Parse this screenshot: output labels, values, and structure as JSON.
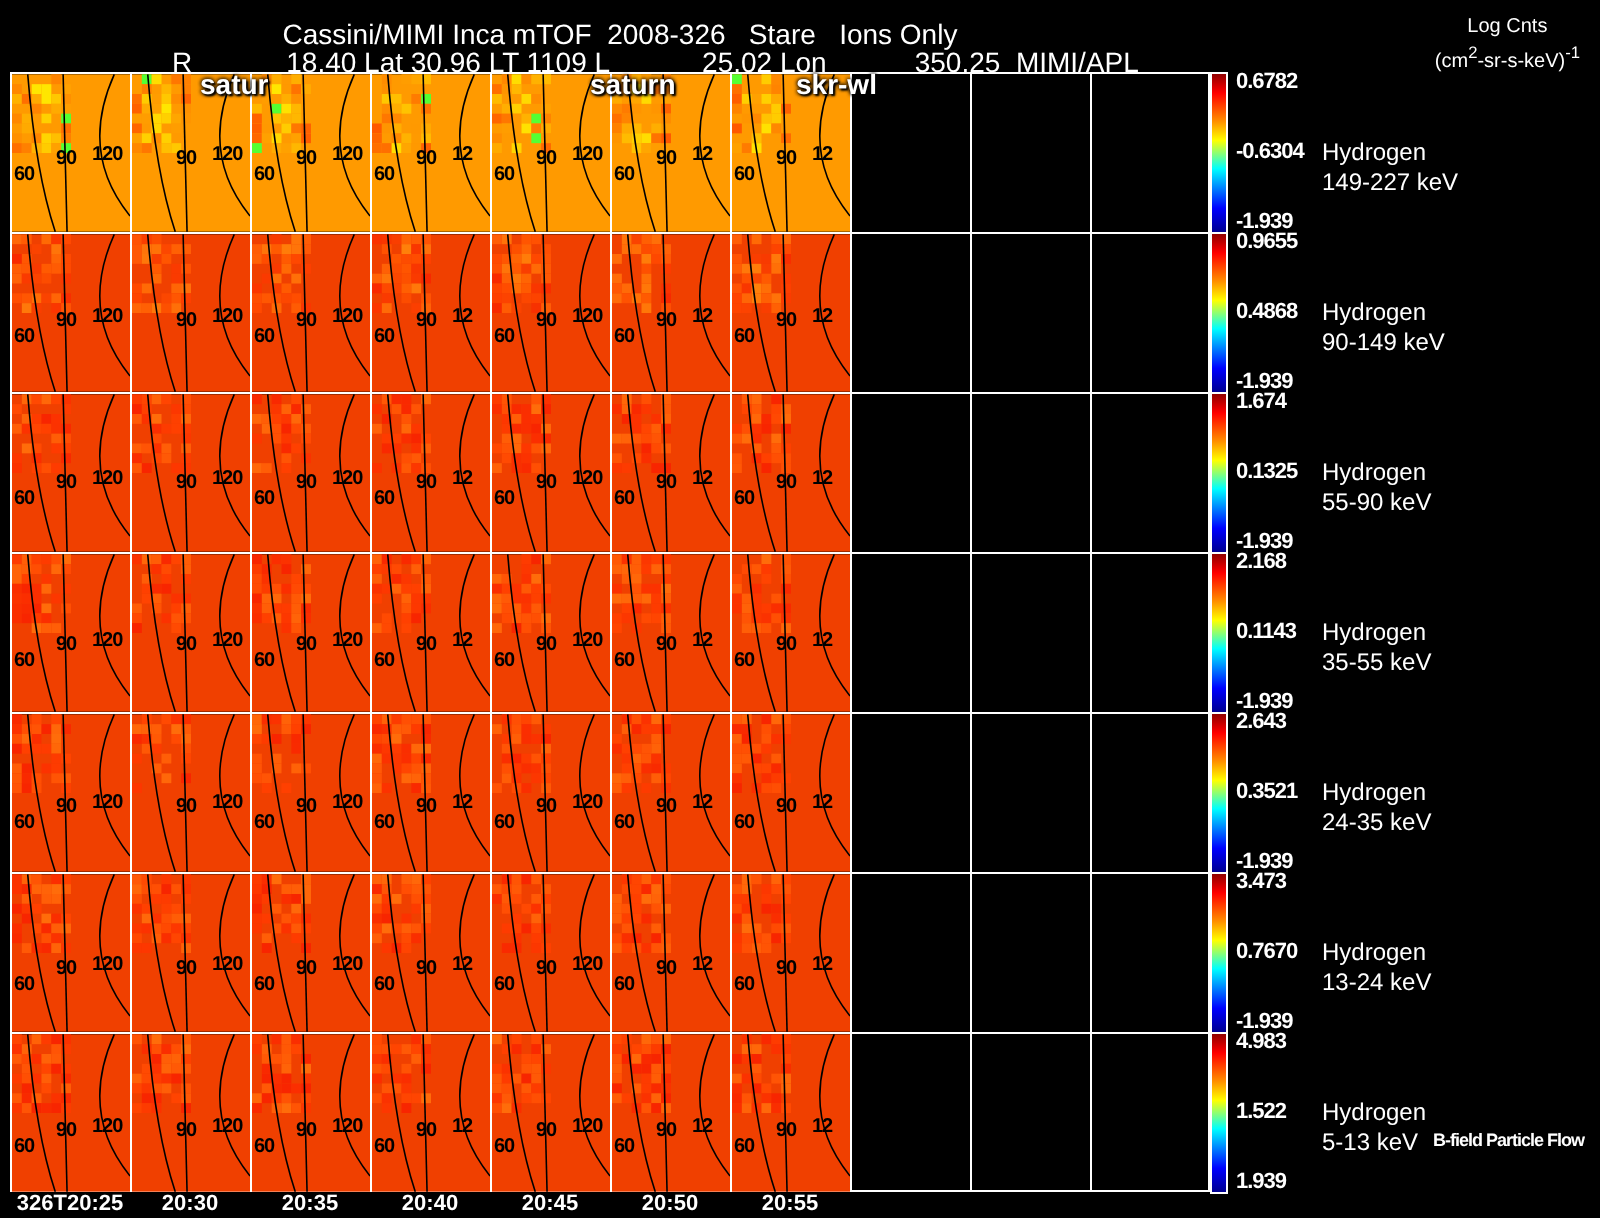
{
  "title": "Cassini/MIMI Inca mTOF  2008-326   Stare   Ions Only",
  "subtitle": [
    "R",
    "18.40 Lat 30.96 LT 1109 L",
    "25.02 Lon",
    "350.25  MIMI/APL"
  ],
  "units": {
    "line1": "Log Cnts",
    "line2": "(cm$^{2}$-sr-s-keV)$^{-1}$"
  },
  "overlay_labels": [
    "satur",
    "saturn",
    "skr-wl"
  ],
  "panels": [
    {
      "species": "Hydrogen",
      "energy": "149-227 keV",
      "scale_max": "0.6782",
      "scale_mid": "-0.6304",
      "scale_min": "-1.939",
      "contours": [
        [
          "60",
          "90",
          "120"
        ],
        [
          "90",
          "120"
        ],
        [
          "60",
          "90",
          "120"
        ],
        [
          "60",
          "90",
          "12"
        ],
        [
          "60",
          "90",
          "120"
        ],
        [
          "60",
          "90",
          "12"
        ],
        [
          "60",
          "90",
          "12"
        ]
      ]
    },
    {
      "species": "Hydrogen",
      "energy": "90-149 keV",
      "scale_max": "0.9655",
      "scale_mid": "0.4868",
      "scale_min": "-1.939",
      "contours": [
        [
          "60",
          "90",
          "120"
        ],
        [
          "90",
          "120"
        ],
        [
          "60",
          "90",
          "120"
        ],
        [
          "60",
          "90",
          "12"
        ],
        [
          "60",
          "90",
          "120"
        ],
        [
          "60",
          "90",
          "12"
        ],
        [
          "60",
          "90",
          "12"
        ]
      ]
    },
    {
      "species": "Hydrogen",
      "energy": "55-90 keV",
      "scale_max": "1.674",
      "scale_mid": "0.1325",
      "scale_min": "-1.939",
      "contours": [
        [
          "60",
          "90",
          "120"
        ],
        [
          "90",
          "120"
        ],
        [
          "60",
          "90",
          "120"
        ],
        [
          "60",
          "90",
          "12"
        ],
        [
          "60",
          "90",
          "120"
        ],
        [
          "60",
          "90",
          "12"
        ],
        [
          "60",
          "90",
          "12"
        ]
      ]
    },
    {
      "species": "Hydrogen",
      "energy": "35-55 keV",
      "scale_max": "2.168",
      "scale_mid": "0.1143",
      "scale_min": "-1.939",
      "contours": [
        [
          "60",
          "90",
          "120"
        ],
        [
          "90",
          "120"
        ],
        [
          "60",
          "90",
          "120"
        ],
        [
          "60",
          "90",
          "12"
        ],
        [
          "60",
          "90",
          "120"
        ],
        [
          "60",
          "90",
          "12"
        ],
        [
          "60",
          "90",
          "12"
        ]
      ]
    },
    {
      "species": "Hydrogen",
      "energy": "24-35 keV",
      "scale_max": "2.643",
      "scale_mid": "0.3521",
      "scale_min": "-1.939",
      "contours": [
        [
          "60",
          "90",
          "120"
        ],
        [
          "90",
          "120"
        ],
        [
          "60",
          "90",
          "120"
        ],
        [
          "60",
          "90",
          "12"
        ],
        [
          "60",
          "90",
          "120"
        ],
        [
          "60",
          "90",
          "12"
        ],
        [
          "60",
          "90",
          "12"
        ]
      ]
    },
    {
      "species": "Hydrogen",
      "energy": "13-24 keV",
      "scale_max": "3.473",
      "scale_mid": "0.7670",
      "scale_min": "-1.939",
      "contours": [
        [
          "60",
          "90",
          "120"
        ],
        [
          "90",
          "120"
        ],
        [
          "60",
          "90",
          "120"
        ],
        [
          "60",
          "90",
          "12"
        ],
        [
          "60",
          "90",
          "120"
        ],
        [
          "60",
          "90",
          "12"
        ],
        [
          "60",
          "90",
          "12"
        ]
      ]
    },
    {
      "species": "Hydrogen",
      "energy": "5-13 keV",
      "scale_max": "4.983",
      "scale_mid": "1.522",
      "scale_min": "1.939",
      "contours": [
        [
          "60",
          "90",
          "120"
        ],
        [
          "90",
          "120"
        ],
        [
          "60",
          "90",
          "120"
        ],
        [
          "60",
          "90",
          "12"
        ],
        [
          "60",
          "90",
          "120"
        ],
        [
          "60",
          "90",
          "12"
        ],
        [
          "60",
          "90",
          "12"
        ]
      ]
    }
  ],
  "times": [
    "326T20:25",
    "20:30",
    "20:35",
    "20:40",
    "20:45",
    "20:50",
    "20:55"
  ],
  "footnote": "B-field Particle Flow"
}
